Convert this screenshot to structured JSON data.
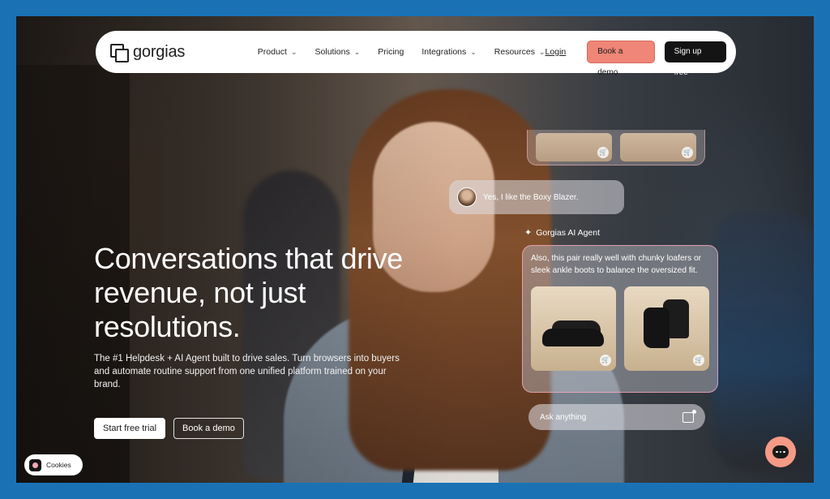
{
  "nav": {
    "logo_text": "gorgias",
    "menu": [
      {
        "label": "Product",
        "has_dropdown": true
      },
      {
        "label": "Solutions",
        "has_dropdown": true
      },
      {
        "label": "Pricing",
        "has_dropdown": false
      },
      {
        "label": "Integrations",
        "has_dropdown": true
      },
      {
        "label": "Resources",
        "has_dropdown": true
      }
    ],
    "login_label": "Login",
    "book_demo_label": "Book a demo",
    "signup_label": "Sign up free"
  },
  "hero": {
    "title": "Conversations that drive revenue, not just resolutions.",
    "subtitle": "The #1 Helpdesk + AI Agent built to drive sales. Turn browsers into buyers and automate routine support from one unified platform trained on your brand.",
    "trial_label": "Start free trial",
    "demo_label": "Book a demo"
  },
  "chat": {
    "user_message": "Yes, I like the Boxy Blazer.",
    "agent_name": "Gorgias AI Agent",
    "agent_message": "Also, this pair really well with chunky loafers or sleek ankle boots to balance the oversized fit.",
    "input_placeholder": "Ask anything"
  },
  "widgets": {
    "cookies_label": "Cookies"
  },
  "colors": {
    "border_frame": "#1a72b5",
    "accent_coral": "#ef8677",
    "dark_button": "#141414"
  },
  "icons": {
    "chevron": "chevron-down-icon",
    "cart": "cart-icon",
    "sparkle": "sparkle-icon",
    "image_upload": "image-upload-icon",
    "chat": "chat-icon"
  }
}
